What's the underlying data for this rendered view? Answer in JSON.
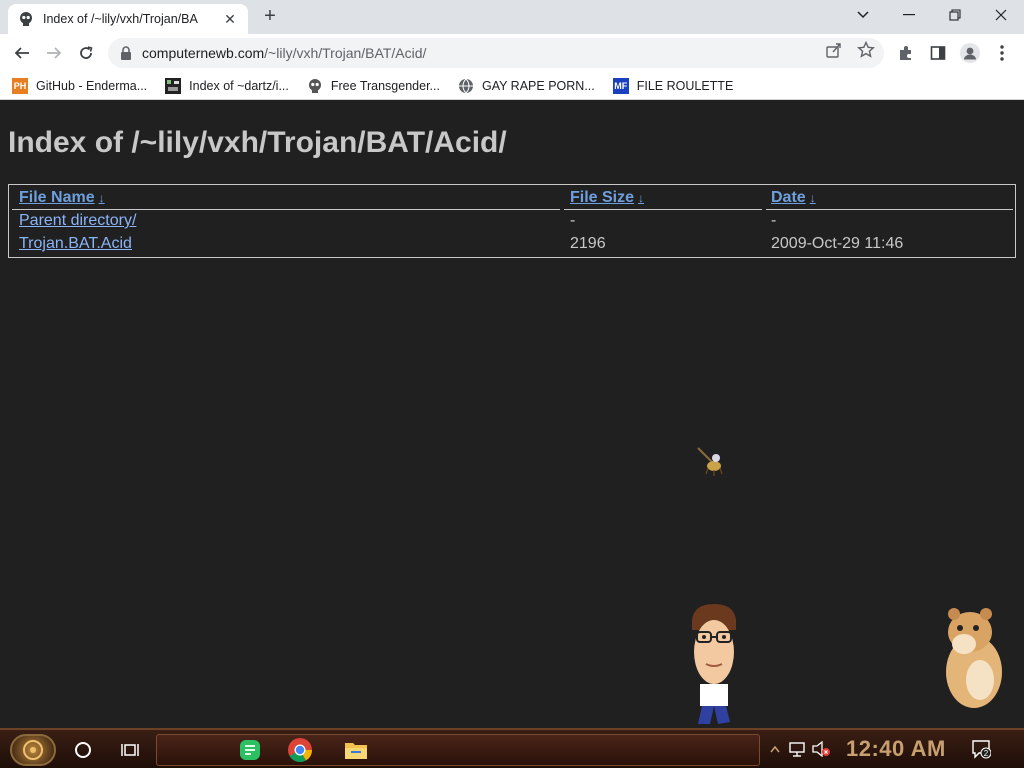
{
  "browser": {
    "tab": {
      "title": "Index of /~lily/vxh/Trojan/BA",
      "close_glyph": "✕"
    },
    "new_tab_glyph": "+",
    "window_controls": {
      "minimize": "—",
      "restore": "❐",
      "close": "✕",
      "tabs_menu": "⌄"
    },
    "address": {
      "host": "computernewb.com",
      "path": "/~lily/vxh/Trojan/BAT/Acid/"
    },
    "bookmarks": [
      {
        "label": "GitHub - Enderma...",
        "icon": "ph-icon",
        "icon_text": "PH",
        "icon_color": "#e67e22"
      },
      {
        "label": "Index of ~dartz/i...",
        "icon": "pixel-icon",
        "icon_text": "",
        "icon_color": "#333333"
      },
      {
        "label": "Free Transgender...",
        "icon": "skull-icon",
        "icon_text": "",
        "icon_color": "#555555"
      },
      {
        "label": "GAY RAPE PORN...",
        "icon": "globe-icon",
        "icon_text": "",
        "icon_color": "#5f6368"
      },
      {
        "label": "FILE ROULETTE",
        "icon": "mft-icon",
        "icon_text": "MF",
        "icon_color": "#1a3fbf"
      }
    ]
  },
  "page": {
    "heading": "Index of /~lily/vxh/Trojan/BAT/Acid/",
    "columns": [
      {
        "label": "File Name",
        "sort": "↓"
      },
      {
        "label": "File Size",
        "sort": "↓"
      },
      {
        "label": "Date",
        "sort": "↓"
      }
    ],
    "rows": [
      {
        "name": "Parent directory/",
        "size": "-",
        "date": "-"
      },
      {
        "name": "Trojan.BAT.Acid",
        "size": "2196",
        "date": "2009-Oct-29 11:46"
      }
    ]
  },
  "taskbar": {
    "clock": "12:40 AM",
    "notification_count": "2"
  },
  "colors": {
    "page_bg": "#202020",
    "text": "#c8c8c8",
    "link": "#8ab4f8",
    "clock": "#c8a070"
  }
}
